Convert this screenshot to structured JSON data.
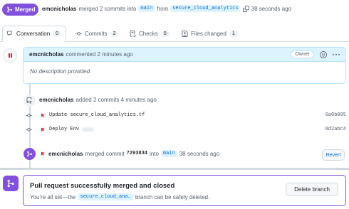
{
  "header": {
    "state": "Merged",
    "author": "emcnicholas",
    "action": "merged 2 commits into",
    "base_branch": "main",
    "from_word": "from",
    "head_branch": "secure_cloud_analytics",
    "time": "38 seconds ago"
  },
  "tabs": [
    {
      "label": "Conversation",
      "count": "0"
    },
    {
      "label": "Commits",
      "count": "2"
    },
    {
      "label": "Checks",
      "count": "0"
    },
    {
      "label": "Files changed",
      "count": "1"
    }
  ],
  "comment": {
    "author": "emcnicholas",
    "action": "commented 2 minutes ago",
    "role": "Owner",
    "body": "No description provided."
  },
  "commits_event": {
    "author": "emcnicholas",
    "action": "added 2 commits 4 minutes ago"
  },
  "commits": [
    {
      "message": "Update secure_cloud_analytics.tf",
      "sha": "0a0b005"
    },
    {
      "message": "Deploy Env",
      "sha": "8d2abc4",
      "more": "···"
    }
  ],
  "merge_event": {
    "author": "emcnicholas",
    "action": "merged commit",
    "sha": "7293834",
    "into": "into",
    "branch": "main",
    "time": "38 seconds ago",
    "revert_label": "Revert"
  },
  "merged_box": {
    "title": "Pull request successfully merged and closed",
    "desc_prefix": "You're all set—the",
    "branch": "secure_cloud_ana…",
    "desc_suffix": "branch can be safely deleted.",
    "delete_label": "Delete branch"
  },
  "colors": {
    "accent": "#8250df",
    "link": "#0969da",
    "comment_bg": "#ddf4ff"
  }
}
